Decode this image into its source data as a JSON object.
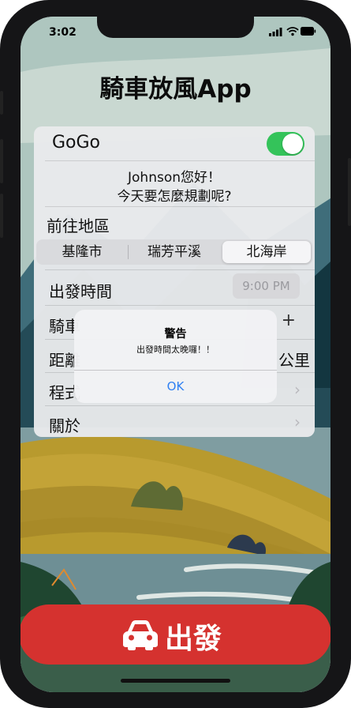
{
  "status_bar": {
    "time": "3:02"
  },
  "app": {
    "title": "騎車放風App"
  },
  "form": {
    "gogo_label": "GoGo",
    "gogo_toggle_on": true,
    "greeting_line1": "Johnson您好！",
    "greeting_line2": "今天要怎麼規劃呢?",
    "destination_label": "前往地區",
    "destinations": [
      "基隆市",
      "瑞芳平溪",
      "北海岸"
    ],
    "selected_destination": "北海岸",
    "departure_label": "出發時間",
    "departure_time": "9:00 PM",
    "bike_label_partial": "騎車",
    "stepper_plus": "+",
    "distance_label_partial": "距離",
    "distance_unit_partial": "公里",
    "program_label_partial": "程式",
    "about_label": "關於"
  },
  "alert": {
    "title": "警告",
    "message": "出發時間太晚囉！！",
    "ok_label": "OK"
  },
  "go_button": {
    "label": "出發",
    "icon": "car-icon"
  },
  "colors": {
    "toggle_on": "#34c35a",
    "go_button": "#d5322f",
    "alert_action": "#2f80f2"
  }
}
